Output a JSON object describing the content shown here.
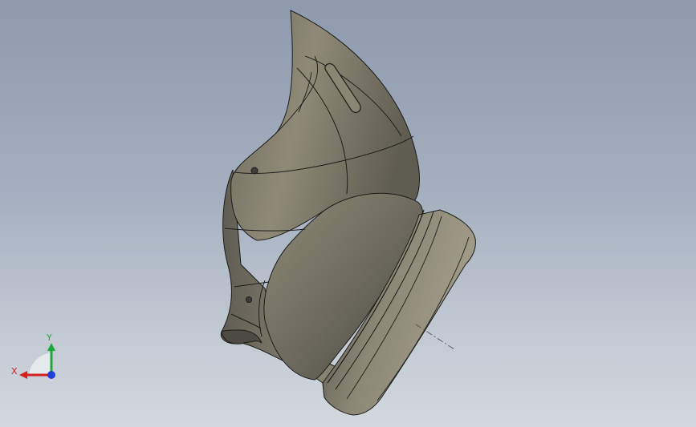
{
  "viewport": {
    "background_top": "#8d9aae",
    "background_bottom": "#d3d8de"
  },
  "model": {
    "face_color": "#7f7b6b",
    "edge_color": "#1c1c1a"
  },
  "triad": {
    "x_label": "X",
    "y_label": "Y",
    "x_color": "#d42020",
    "y_color": "#1fa83a",
    "z_color": "#2040d8"
  }
}
